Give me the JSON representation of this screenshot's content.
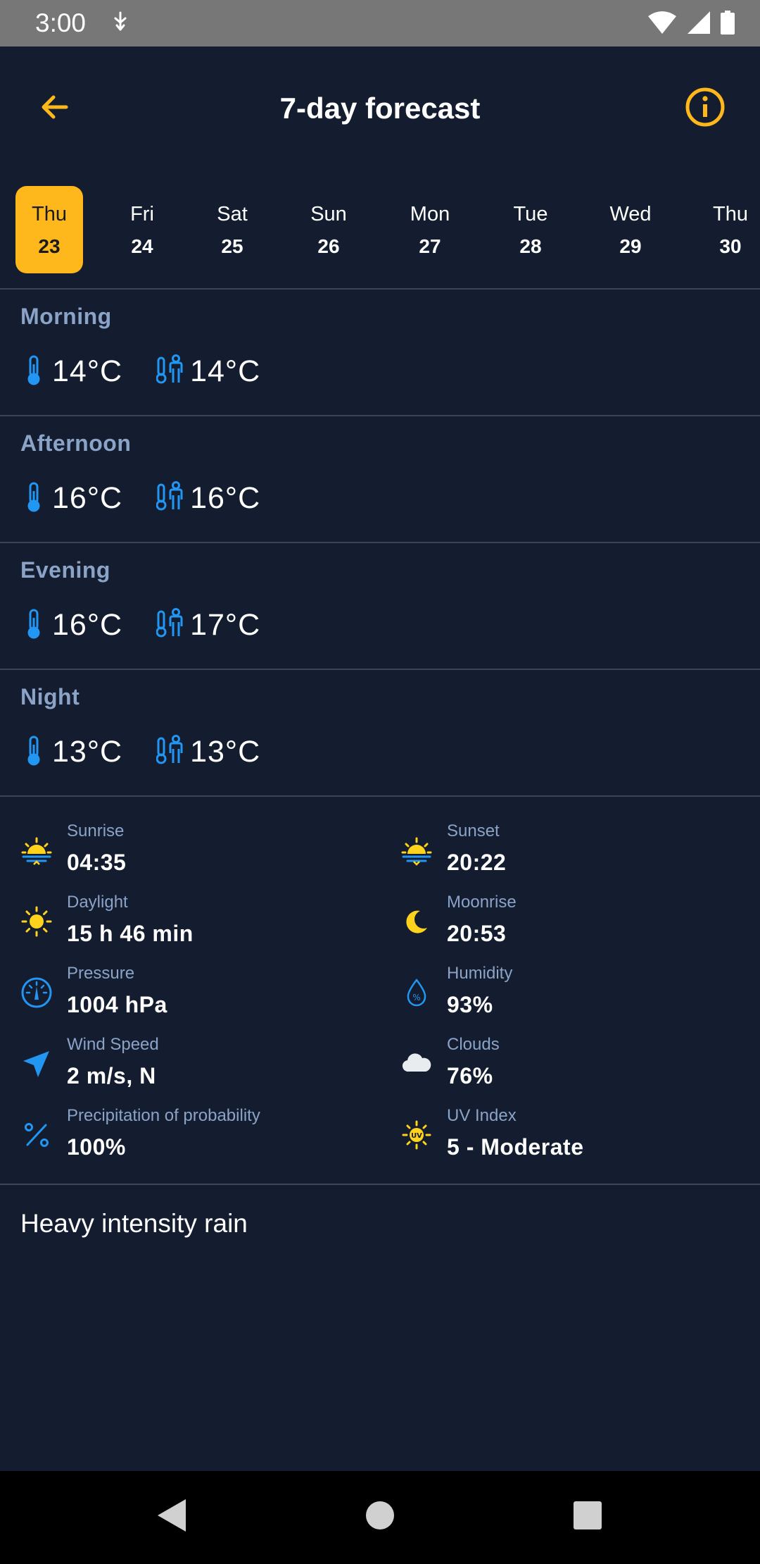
{
  "status_bar": {
    "time": "3:00"
  },
  "header": {
    "title": "7-day forecast"
  },
  "days": [
    {
      "name": "Thu",
      "num": "23",
      "selected": true
    },
    {
      "name": "Fri",
      "num": "24"
    },
    {
      "name": "Sat",
      "num": "25"
    },
    {
      "name": "Sun",
      "num": "26"
    },
    {
      "name": "Mon",
      "num": "27"
    },
    {
      "name": "Tue",
      "num": "28"
    },
    {
      "name": "Wed",
      "num": "29"
    },
    {
      "name": "Thu",
      "num": "30"
    }
  ],
  "periods": [
    {
      "label": "Morning",
      "temp": "14°C",
      "feels": "14°C"
    },
    {
      "label": "Afternoon",
      "temp": "16°C",
      "feels": "16°C"
    },
    {
      "label": "Evening",
      "temp": "16°C",
      "feels": "17°C"
    },
    {
      "label": "Night",
      "temp": "13°C",
      "feels": "13°C"
    }
  ],
  "details": [
    {
      "label": "Sunrise",
      "value": "04:35",
      "icon": "sunrise-icon"
    },
    {
      "label": "Sunset",
      "value": "20:22",
      "icon": "sunset-icon"
    },
    {
      "label": "Daylight",
      "value": "15 h 46 min",
      "icon": "sun-icon"
    },
    {
      "label": "Moonrise",
      "value": "20:53",
      "icon": "moon-icon"
    },
    {
      "label": "Pressure",
      "value": "1004 hPa",
      "icon": "gauge-icon"
    },
    {
      "label": "Humidity",
      "value": "93%",
      "icon": "humidity-drop-icon"
    },
    {
      "label": "Wind Speed",
      "value": "2 m/s, N",
      "icon": "wind-direction-icon"
    },
    {
      "label": "Clouds",
      "value": "76%",
      "icon": "cloud-icon"
    },
    {
      "label": "Precipitation of probability",
      "value": "100%",
      "icon": "percent-icon"
    },
    {
      "label": "UV Index",
      "value": "5 - Moderate",
      "icon": "uv-icon"
    }
  ],
  "description": "Heavy intensity rain",
  "colors": {
    "background": "#141c2f",
    "accent": "#ffb81c",
    "label": "#8aa3c7",
    "icon_blue": "#2196f3",
    "sun_yellow": "#ffd21c"
  }
}
